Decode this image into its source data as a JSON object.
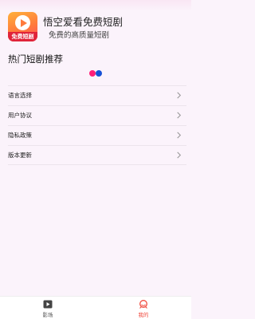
{
  "app": {
    "title": "悟空爱看免费短剧",
    "subtitle": "免费的高质量短剧",
    "logo_badge": "免费短剧"
  },
  "section": {
    "title": "热门短剧推荐"
  },
  "menu": {
    "items": [
      {
        "label": "语言选择"
      },
      {
        "label": "用户协议"
      },
      {
        "label": "隐私政策"
      },
      {
        "label": "版本更新"
      }
    ]
  },
  "tabbar": {
    "tabs": [
      {
        "label": "影场",
        "icon": "play-icon",
        "active": false
      },
      {
        "label": "我的",
        "icon": "profile-icon",
        "active": true
      }
    ]
  },
  "colors": {
    "background": "#fbf3fb",
    "accent": "#f04a3e",
    "loading_pink": "#ff1e78",
    "loading_blue": "#1651d6"
  }
}
